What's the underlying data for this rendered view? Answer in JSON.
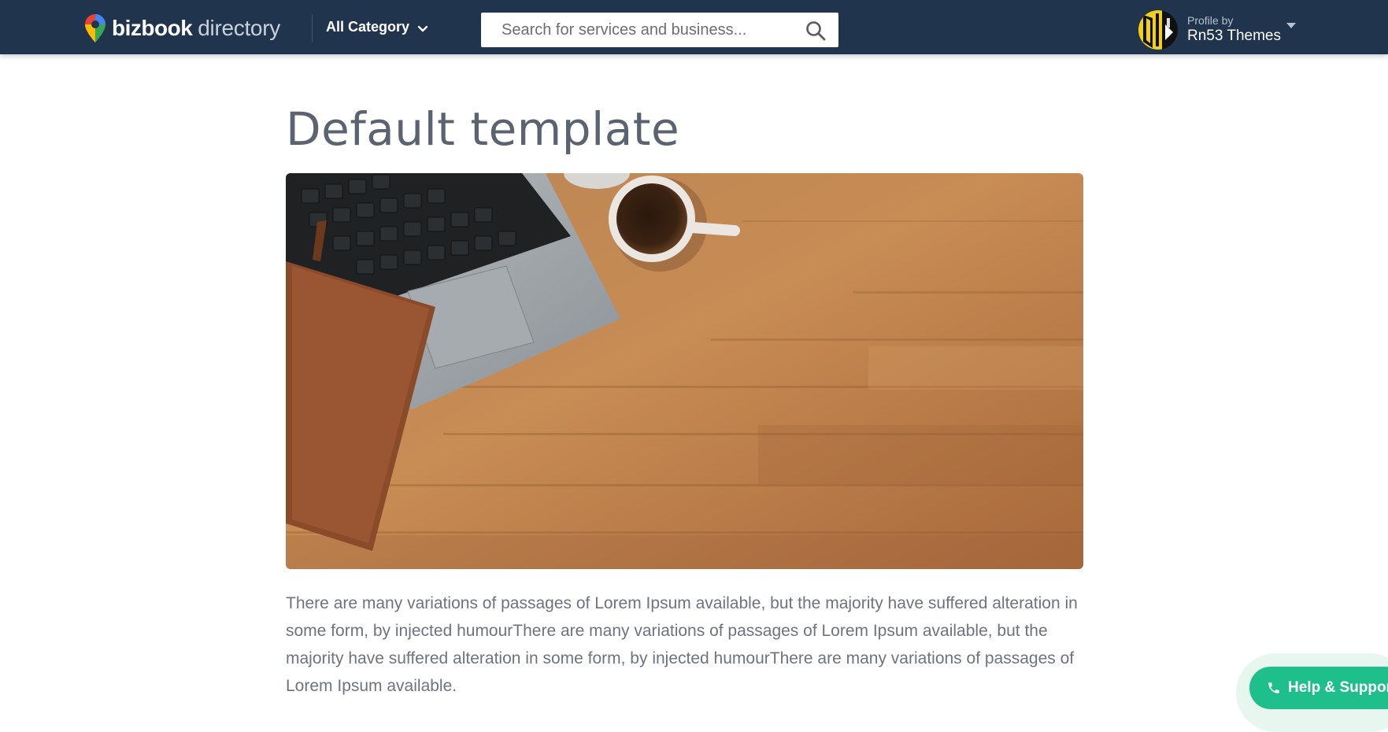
{
  "header": {
    "logo_bold": "bizbook",
    "logo_light": "directory",
    "category_label": "All Category",
    "search_placeholder": "Search for services and business...",
    "profile_by": "Profile by",
    "profile_name": "Rn53 Themes"
  },
  "main": {
    "title": "Default template",
    "paragraph": "There are many variations of passages of Lorem Ipsum available, but the majority have suffered alteration in some form, by injected humourThere are many variations of passages of Lorem Ipsum available, but the majority have suffered alteration in some form, by injected humourThere are many variations of passages of Lorem Ipsum available."
  },
  "help": {
    "label": "Help & Support"
  },
  "colors": {
    "header_bg": "#21344d",
    "accent_green": "#1fbf8b",
    "title_text": "#5c6370",
    "body_text": "#6f7380"
  },
  "icons": [
    "map-pin-logo-icon",
    "chevron-down-icon",
    "search-icon",
    "caret-down-icon",
    "phone-icon"
  ]
}
